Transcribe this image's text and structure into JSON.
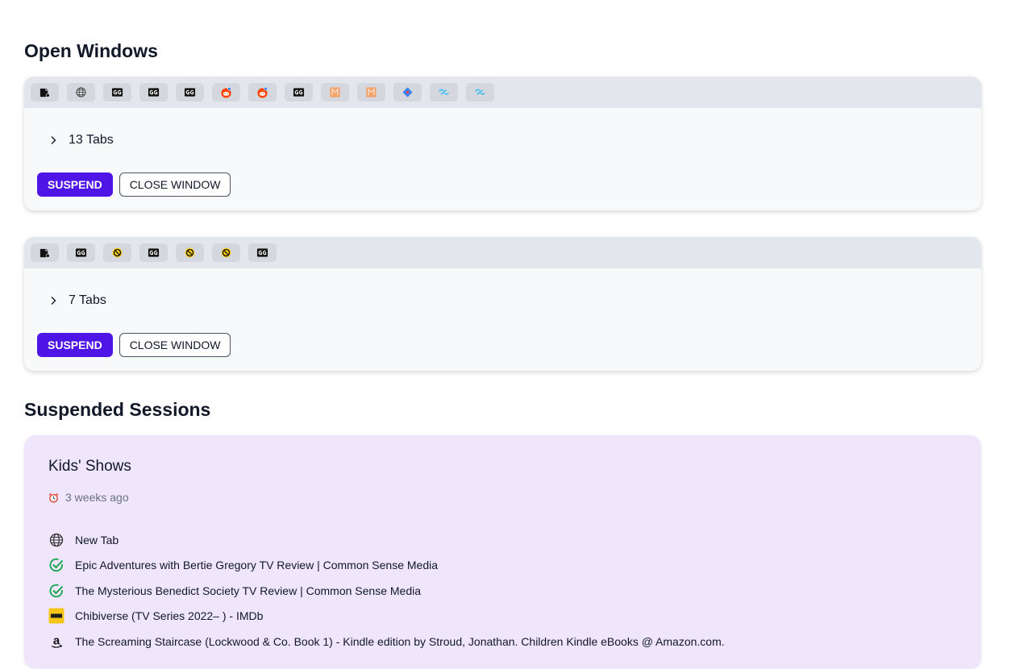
{
  "open_windows": {
    "title": "Open Windows",
    "windows": [
      {
        "tab_count_label": "13 Tabs",
        "favicons": [
          "extension-icon",
          "globe-icon",
          "gg-icon",
          "gg-icon",
          "gg-icon",
          "reddit-icon",
          "reddit-icon",
          "gg-icon",
          "m-icon",
          "m-icon",
          "diamond-icon",
          "tailwind-icon",
          "tailwind-icon"
        ],
        "suspend_label": "SUSPEND",
        "close_label": "CLOSE WINDOW"
      },
      {
        "tab_count_label": "7 Tabs",
        "favicons": [
          "extension-icon",
          "gg-icon",
          "block-icon",
          "gg-icon",
          "block-icon",
          "block-icon",
          "gg-icon"
        ],
        "suspend_label": "SUSPEND",
        "close_label": "CLOSE WINDOW"
      }
    ]
  },
  "suspended_sessions": {
    "title": "Suspended Sessions",
    "sessions": [
      {
        "name": "Kids' Shows",
        "time": "3 weeks ago",
        "tabs": [
          {
            "icon": "globe-icon",
            "title": "New Tab"
          },
          {
            "icon": "check-circle-icon",
            "title": "Epic Adventures with Bertie Gregory TV Review | Common Sense Media"
          },
          {
            "icon": "check-circle-icon",
            "title": "The Mysterious Benedict Society TV Review | Common Sense Media"
          },
          {
            "icon": "imdb-icon",
            "title": "Chibiverse (TV Series 2022– ) - IMDb"
          },
          {
            "icon": "amazon-icon",
            "title": "The Screaming Staircase (Lockwood & Co. Book 1) - Kindle edition by Stroud, Jonathan. Children Kindle eBooks @ Amazon.com."
          }
        ]
      }
    ]
  },
  "colors": {
    "accent": "#4f14e6",
    "session_card": "#efe6fb",
    "window_card": "#f8f9fb",
    "favicon_strip": "#e3e6ec"
  }
}
